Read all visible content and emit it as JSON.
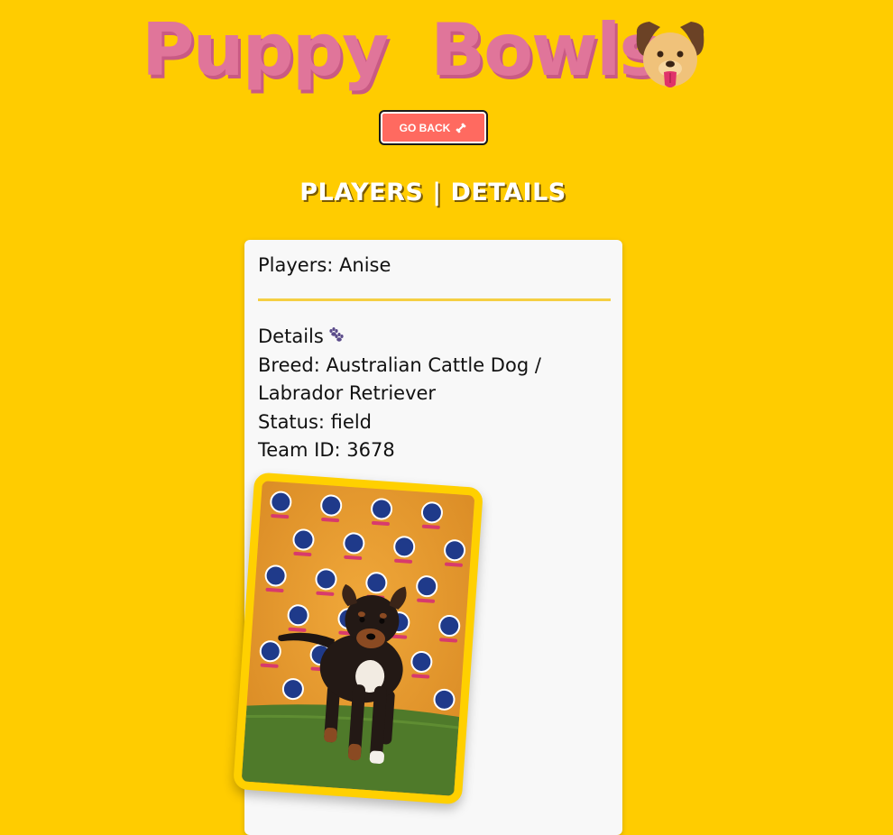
{
  "header": {
    "title": "Puppy Bowls",
    "logo_icon": "dog-face-icon"
  },
  "back_button": {
    "label": "GO BACK",
    "icon": "bone-icon"
  },
  "section": {
    "heading": "PLAYERS | DETAILS"
  },
  "player": {
    "title": "Players: Anise",
    "details_label": "Details",
    "details_icon": "paw-prints-icon",
    "breed": "Breed: Australian Cattle Dog / Labrador Retriever",
    "status": "Status: field",
    "team_id": "Team ID: 3678",
    "photo_icon": "puppy-photo"
  },
  "colors": {
    "background": "#ffcc00",
    "title": "#e0759a",
    "button": "#ff6a60",
    "card": "#f8f8f8",
    "divider": "#f5cf43",
    "photo_frame": "#ffd000"
  }
}
